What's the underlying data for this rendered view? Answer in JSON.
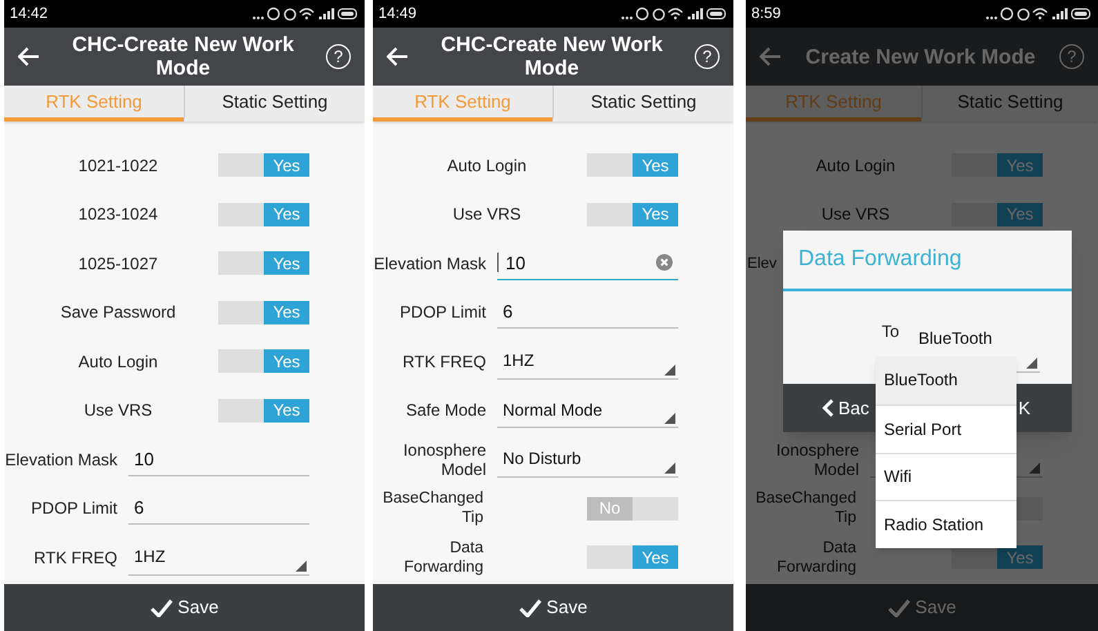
{
  "panels": [
    {
      "status_bar": {
        "time": "14:42"
      },
      "header": {
        "title": "CHC-Create New Work Mode",
        "help": "?"
      },
      "tabs": [
        {
          "label": "RTK Setting",
          "selected": true
        },
        {
          "label": "Static Setting",
          "selected": false
        }
      ],
      "dimmed": false,
      "rows": [
        {
          "kind": "toggle",
          "label": "1021-1022",
          "on": true,
          "text": "Yes"
        },
        {
          "kind": "toggle",
          "label": "1023-1024",
          "on": true,
          "text": "Yes"
        },
        {
          "kind": "toggle",
          "label": "1025-1027",
          "on": true,
          "text": "Yes"
        },
        {
          "kind": "toggle",
          "label": "Save Password",
          "on": true,
          "text": "Yes"
        },
        {
          "kind": "toggle",
          "label": "Auto Login",
          "on": true,
          "text": "Yes"
        },
        {
          "kind": "toggle",
          "label": "Use VRS",
          "on": true,
          "text": "Yes"
        },
        {
          "kind": "text",
          "label": "Elevation Mask",
          "value": "10",
          "focused": false
        },
        {
          "kind": "text",
          "label": "PDOP Limit",
          "value": "6",
          "focused": false
        },
        {
          "kind": "select",
          "label": "RTK FREQ",
          "value": "1HZ"
        }
      ],
      "save_button": "Save"
    },
    {
      "status_bar": {
        "time": "14:49"
      },
      "header": {
        "title": "CHC-Create New Work Mode",
        "help": "?"
      },
      "tabs": [
        {
          "label": "RTK Setting",
          "selected": true
        },
        {
          "label": "Static Setting",
          "selected": false
        }
      ],
      "dimmed": false,
      "rows": [
        {
          "kind": "toggle",
          "label": "Auto Login",
          "on": true,
          "text": "Yes"
        },
        {
          "kind": "toggle",
          "label": "Use VRS",
          "on": true,
          "text": "Yes"
        },
        {
          "kind": "text",
          "label": "Elevation Mask",
          "value": "10",
          "focused": true
        },
        {
          "kind": "text",
          "label": "PDOP Limit",
          "value": "6",
          "focused": false
        },
        {
          "kind": "select",
          "label": "RTK FREQ",
          "value": "1HZ"
        },
        {
          "kind": "select",
          "label": "Safe Mode",
          "value": "Normal Mode"
        },
        {
          "kind": "select",
          "label": "Ionosphere Model",
          "value": "No Disturb"
        },
        {
          "kind": "flag",
          "label": "BaseChanged Tip",
          "on": false,
          "text": "No"
        },
        {
          "kind": "flag",
          "label": "Data Forwarding",
          "on": true,
          "text": "Yes"
        }
      ],
      "save_button": "Save"
    },
    {
      "status_bar": {
        "time": "8:59"
      },
      "header": {
        "title": "Create New Work Mode",
        "help": "?"
      },
      "tabs": [
        {
          "label": "RTK Setting",
          "selected": true
        },
        {
          "label": "Static Setting",
          "selected": false
        }
      ],
      "dimmed": true,
      "rows": [
        {
          "kind": "toggle",
          "label": "Auto Login",
          "on": true,
          "text": "Yes"
        },
        {
          "kind": "toggle",
          "label": "Use VRS",
          "on": true,
          "text": "Yes"
        },
        {
          "kind": "covered",
          "label": "Elev"
        },
        {
          "kind": "select",
          "label": "Ionosphere Model"
        },
        {
          "kind": "flag",
          "label": "BaseChanged Tip",
          "on": false
        },
        {
          "kind": "flag",
          "label": "Data Forwarding",
          "on": true,
          "text": "Yes"
        }
      ],
      "save_button": "Save",
      "dialog": {
        "title": "Data Forwarding",
        "field_label": "To",
        "value": "BlueTooth",
        "buttons": [
          "Bac",
          "K"
        ],
        "options": [
          {
            "label": "BlueTooth",
            "selected": true
          },
          {
            "label": "Serial Port",
            "selected": false
          },
          {
            "label": "Wifi",
            "selected": false
          },
          {
            "label": "Radio Station",
            "selected": false
          }
        ]
      }
    }
  ]
}
